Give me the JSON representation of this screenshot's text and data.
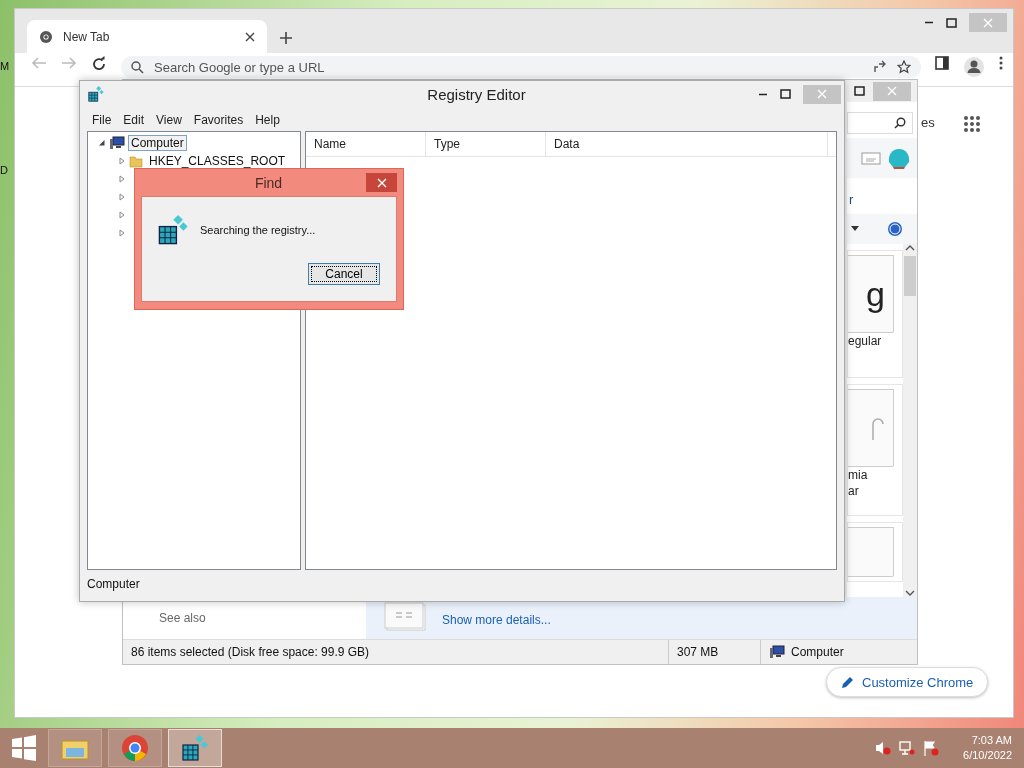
{
  "desktop": {
    "edge_labels": [
      "M",
      "D"
    ]
  },
  "browser": {
    "tabs": [
      {
        "title": "New Tab",
        "selected": true
      }
    ],
    "omnibox": {
      "placeholder": "Search Google or type a URL"
    },
    "shortcut_label": "es",
    "customize_button": "Customize Chrome"
  },
  "explorer": {
    "pane_fragment": "r",
    "files": [
      {
        "kind": "glyph",
        "preview": "g",
        "caption": [
          "egular"
        ]
      },
      {
        "kind": "arch",
        "caption": [
          "mia",
          "ar"
        ]
      },
      {
        "kind": "blank"
      }
    ],
    "see_also": "See also",
    "details_link": "Show more details...",
    "status": {
      "selection": "86 items selected (Disk free space: 99.9 GB)",
      "size": "307 MB",
      "location": "Computer"
    }
  },
  "registry_editor": {
    "title": "Registry Editor",
    "menu": [
      "File",
      "Edit",
      "View",
      "Favorites",
      "Help"
    ],
    "tree": [
      {
        "label": "Computer",
        "selected": true,
        "expanded": true,
        "children": [
          {
            "label": "HKEY_CLASSES_ROOT",
            "expanded": false
          },
          {
            "expanded": false
          },
          {
            "expanded": false
          },
          {
            "expanded": false
          },
          {
            "expanded": false
          }
        ]
      }
    ],
    "columns": [
      "Name",
      "Type",
      "Data"
    ],
    "status": "Computer"
  },
  "find_dialog": {
    "title": "Find",
    "message": "Searching the registry...",
    "button": "Cancel"
  },
  "taskbar": {
    "apps": [
      {
        "kind": "explorer",
        "selected": false
      },
      {
        "kind": "chrome",
        "selected": false
      },
      {
        "kind": "regedit",
        "selected": true
      }
    ],
    "time": "7:03 AM",
    "date": "6/10/2022"
  }
}
